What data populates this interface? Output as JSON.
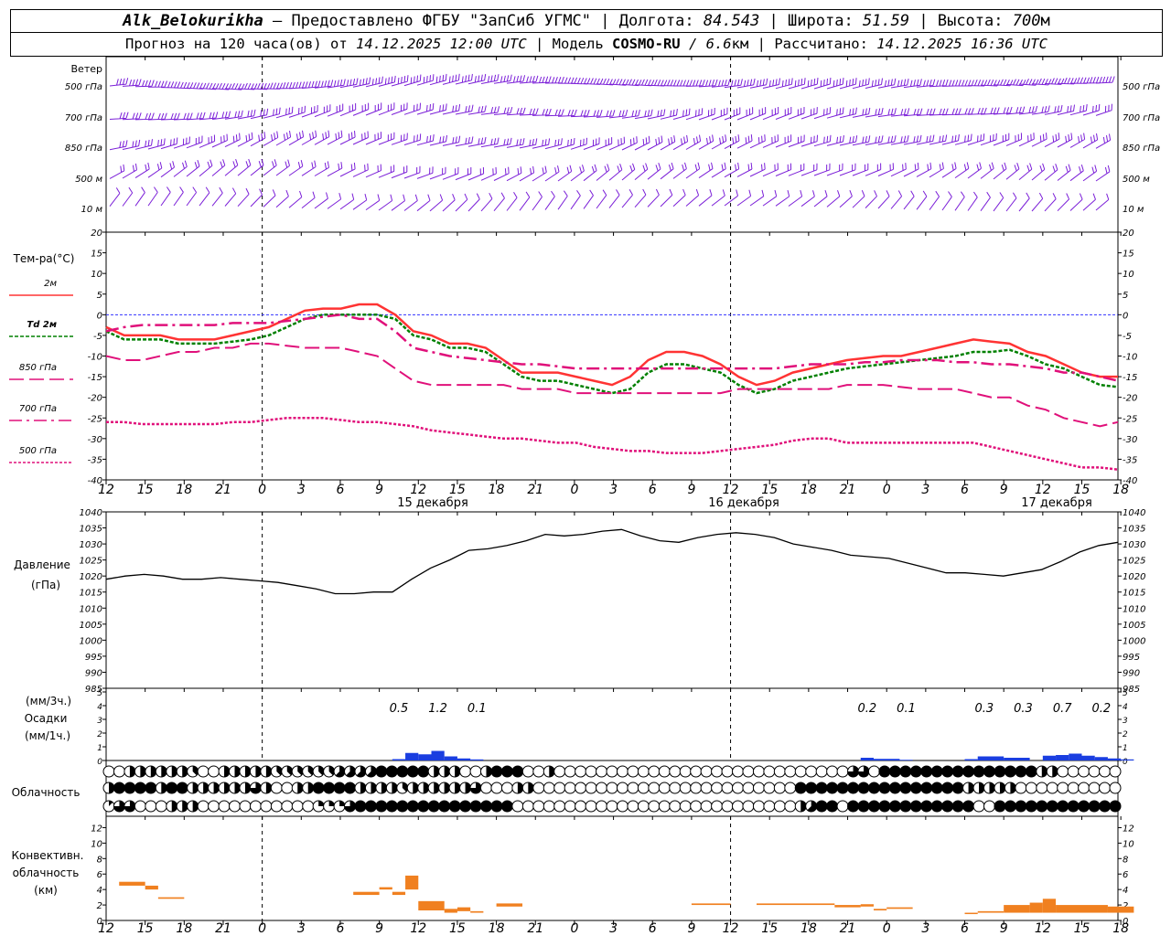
{
  "header": {
    "station": "Alk_Belokurikha",
    "dash": " – ",
    "provider": "Предоставлено ФГБУ \"ЗапСиб УГМС\"",
    "lon_label": "Долгота:",
    "lon_value": "84.543",
    "lat_label": "Широта:",
    "lat_value": "51.59",
    "alt_label": "Высота:",
    "alt_value": "700",
    "alt_unit": "м",
    "sep": " | ",
    "forecast_prefix": "Прогноз на 120 часа(ов) от ",
    "forecast_time": "14.12.2025 12:00 UTC",
    "model_label": "Модель ",
    "model_name": "COSMO-RU",
    "model_res": " / 6.6",
    "model_res_unit": "км",
    "calc_label": "Рассчитано: ",
    "calc_time": "14.12.2025 16:36 UTC"
  },
  "time_axis": {
    "ticks": [
      "12",
      "15",
      "18",
      "21",
      "0",
      "3",
      "6",
      "9",
      "12",
      "15",
      "18",
      "21",
      "0",
      "3",
      "6",
      "9",
      "12",
      "15",
      "18",
      "21",
      "0",
      "3",
      "6",
      "9",
      "12",
      "15",
      "18"
    ],
    "day_labels": [
      "15 декабря",
      "16 декабря",
      "17 декабря"
    ]
  },
  "chart_data": [
    {
      "id": "wind",
      "type": "line",
      "title": "Ветер",
      "levels": [
        "500 гПа",
        "700 гПа",
        "850 гПа",
        "500 м",
        "10 м"
      ]
    },
    {
      "id": "temperature",
      "type": "line",
      "ylabel": "Тем-ра(°С)",
      "ylim": [
        -40,
        20
      ],
      "yticks": [
        20,
        15,
        10,
        5,
        0,
        -5,
        -10,
        -15,
        -20,
        -25,
        -30,
        -35,
        -40
      ],
      "series": [
        {
          "name": "2м",
          "color": "#ff3333",
          "values": [
            -3,
            -5,
            -5,
            -5,
            -6,
            -6,
            -6,
            -5,
            -4,
            -3,
            -1,
            1,
            1.5,
            1.5,
            2.5,
            2.5,
            0,
            -4,
            -5,
            -7,
            -7,
            -8,
            -11,
            -14,
            -14,
            -14,
            -15,
            -16,
            -17,
            -15,
            -11,
            -9,
            -9,
            -10,
            -12,
            -15,
            -17,
            -16,
            -14,
            -13,
            -12,
            -11,
            -10.5,
            -10,
            -10,
            -9,
            -8,
            -7,
            -6,
            -6.5,
            -7,
            -9,
            -10,
            -12,
            -14,
            -15,
            -15
          ]
        },
        {
          "name": "Td 2м",
          "color": "#008000",
          "values": [
            -4,
            -6,
            -6,
            -6,
            -7,
            -7,
            -7,
            -6.5,
            -6,
            -5,
            -3,
            -1,
            0,
            0,
            0,
            0,
            -1,
            -5,
            -6,
            -8,
            -8,
            -9,
            -12,
            -15,
            -16,
            -16,
            -17,
            -18,
            -19,
            -18,
            -14,
            -12,
            -12,
            -13,
            -14,
            -17,
            -19,
            -18,
            -16,
            -15,
            -14,
            -13,
            -12.5,
            -12,
            -11.5,
            -11,
            -10.5,
            -10,
            -9,
            -9,
            -8.5,
            -10,
            -12,
            -13,
            -15,
            -17,
            -17.5
          ]
        },
        {
          "name": "850 гПа",
          "color": "#e0107a",
          "values": [
            -10,
            -11,
            -11,
            -10,
            -9,
            -9,
            -8,
            -8,
            -7,
            -7,
            -7.5,
            -8,
            -8,
            -8,
            -9,
            -10,
            -13,
            -16,
            -17,
            -17,
            -17,
            -17,
            -17,
            -18,
            -18,
            -18,
            -19,
            -19,
            -19,
            -19,
            -19,
            -19,
            -19,
            -19,
            -19,
            -18,
            -18,
            -18,
            -18,
            -18,
            -18,
            -17,
            -17,
            -17,
            -17.5,
            -18,
            -18,
            -18,
            -19,
            -20,
            -20,
            -22,
            -23,
            -25,
            -26,
            -27,
            -26
          ]
        },
        {
          "name": "700 гПа",
          "color": "#e0107a",
          "values": [
            -4,
            -3,
            -2.5,
            -2.5,
            -2.5,
            -2.5,
            -2.5,
            -2,
            -2,
            -2,
            -1.5,
            -1,
            -0.5,
            0,
            -1,
            -1,
            -4,
            -8,
            -9,
            -10,
            -10.5,
            -11,
            -11.5,
            -12,
            -12,
            -12.5,
            -13,
            -13,
            -13,
            -13,
            -13,
            -13,
            -13,
            -13,
            -13,
            -13,
            -13,
            -13,
            -12.5,
            -12,
            -12,
            -12,
            -11.5,
            -11.5,
            -11,
            -11,
            -11,
            -11.5,
            -11.5,
            -12,
            -12,
            -12.5,
            -13,
            -14,
            -14,
            -15,
            -16
          ]
        },
        {
          "name": "500 гПа",
          "color": "#e0107a",
          "values": [
            -26,
            -26,
            -26.5,
            -26.5,
            -26.5,
            -26.5,
            -26.5,
            -26,
            -26,
            -25.5,
            -25,
            -25,
            -25,
            -25.5,
            -26,
            -26,
            -26.5,
            -27,
            -28,
            -28.5,
            -29,
            -29.5,
            -30,
            -30,
            -30.5,
            -31,
            -31,
            -32,
            -32.5,
            -33,
            -33,
            -33.5,
            -33.5,
            -33.5,
            -33,
            -32.5,
            -32,
            -31.5,
            -30.5,
            -30,
            -30,
            -31,
            -31,
            -31,
            -31,
            -31,
            -31,
            -31,
            -31,
            -32,
            -33,
            -34,
            -35,
            -36,
            -37,
            -37,
            -37.5
          ]
        }
      ]
    },
    {
      "id": "pressure",
      "type": "line",
      "ylabel": "Давление",
      "yunit": "(гПа)",
      "ylim": [
        985,
        1040
      ],
      "yticks": [
        1040,
        1035,
        1030,
        1025,
        1020,
        1015,
        1010,
        1005,
        1000,
        995,
        990,
        985
      ],
      "series": [
        {
          "name": "Давление",
          "color": "#000000",
          "values": [
            1019,
            1020,
            1020.5,
            1020,
            1019,
            1019,
            1019.5,
            1019,
            1018.5,
            1018,
            1017,
            1016,
            1014.5,
            1014.5,
            1015,
            1015,
            1019,
            1022.5,
            1025,
            1028,
            1028.5,
            1029.5,
            1031,
            1033,
            1032.5,
            1033,
            1034,
            1034.5,
            1032.5,
            1031,
            1030.5,
            1032,
            1033,
            1033.5,
            1033,
            1032,
            1030,
            1029,
            1028,
            1026.5,
            1026,
            1025.5,
            1024,
            1022.5,
            1021,
            1021,
            1020.5,
            1020,
            1021,
            1022,
            1024.5,
            1027.5,
            1029.5,
            1030.5
          ]
        }
      ]
    },
    {
      "id": "precipitation",
      "type": "bar",
      "ylabel": "(мм/3ч.)",
      "title": "Осадки",
      "yunit": "(мм/1ч.)",
      "ylim": [
        0,
        5
      ],
      "yticks": [
        5,
        4,
        3,
        2,
        1,
        0
      ],
      "totals": [
        {
          "t": 22.5,
          "label": "0.5"
        },
        {
          "t": 25.5,
          "label": "1.2"
        },
        {
          "t": 28.5,
          "label": "0.1"
        },
        {
          "t": 58.5,
          "label": "0.2"
        },
        {
          "t": 61.5,
          "label": "0.1"
        },
        {
          "t": 67.5,
          "label": "0.3"
        },
        {
          "t": 70.5,
          "label": "0.3"
        },
        {
          "t": 73.5,
          "label": "0.7"
        },
        {
          "t": 76.5,
          "label": "0.2"
        }
      ],
      "bars": [
        {
          "t0": 22,
          "t1": 23,
          "v": 0.1
        },
        {
          "t0": 23,
          "t1": 24,
          "v": 0.55
        },
        {
          "t0": 24,
          "t1": 25,
          "v": 0.45
        },
        {
          "t0": 25,
          "t1": 26,
          "v": 0.7
        },
        {
          "t0": 26,
          "t1": 27,
          "v": 0.3
        },
        {
          "t0": 27,
          "t1": 28,
          "v": 0.15
        },
        {
          "t0": 28,
          "t1": 29,
          "v": 0.08
        },
        {
          "t0": 58,
          "t1": 59,
          "v": 0.2
        },
        {
          "t0": 59,
          "t1": 61,
          "v": 0.12
        },
        {
          "t0": 61,
          "t1": 62,
          "v": 0.05
        },
        {
          "t0": 66,
          "t1": 67,
          "v": 0.1
        },
        {
          "t0": 67,
          "t1": 69,
          "v": 0.3
        },
        {
          "t0": 69,
          "t1": 71,
          "v": 0.2
        },
        {
          "t0": 72,
          "t1": 73,
          "v": 0.35
        },
        {
          "t0": 73,
          "t1": 74,
          "v": 0.4
        },
        {
          "t0": 74,
          "t1": 75,
          "v": 0.5
        },
        {
          "t0": 75,
          "t1": 76,
          "v": 0.35
        },
        {
          "t0": 76,
          "t1": 77,
          "v": 0.25
        },
        {
          "t0": 77,
          "t1": 78,
          "v": 0.15
        },
        {
          "t0": 78,
          "t1": 79,
          "v": 0.08
        }
      ]
    },
    {
      "id": "cloudiness",
      "type": "table",
      "ylabel": "Облачность",
      "rows": [
        "0044444430044444333333555588888444004888004000000000000000000000000000066088888888888888844000000",
        "4888848844444464004488884444344444460004400000000000000000000000008888888888888888444440000000000",
        "1660004440000000000022268888888888888880000000000000000000000000004588088888888888800888888888888"
      ]
    },
    {
      "id": "convective",
      "type": "bar",
      "ylabel": "Конвективн.",
      "title": "облачность",
      "yunit": "(км)",
      "ylim": [
        0,
        13
      ],
      "yticks": [
        12,
        10,
        8,
        6,
        4,
        2,
        0
      ],
      "bars": [
        {
          "t0": 1,
          "t1": 3,
          "lo": 4.5,
          "hi": 5
        },
        {
          "t0": 3,
          "t1": 4,
          "lo": 4,
          "hi": 4.5
        },
        {
          "t0": 4,
          "t1": 6,
          "lo": 2.8,
          "hi": 3
        },
        {
          "t0": 19,
          "t1": 21,
          "lo": 3.3,
          "hi": 3.7
        },
        {
          "t0": 21,
          "t1": 22,
          "lo": 4,
          "hi": 4.3
        },
        {
          "t0": 22,
          "t1": 23,
          "lo": 3.3,
          "hi": 3.7
        },
        {
          "t0": 23,
          "t1": 24,
          "lo": 4,
          "hi": 5.8
        },
        {
          "t0": 24,
          "t1": 26,
          "lo": 1.3,
          "hi": 2.5
        },
        {
          "t0": 26,
          "t1": 27,
          "lo": 1,
          "hi": 1.5
        },
        {
          "t0": 27,
          "t1": 28,
          "lo": 1.2,
          "hi": 1.7
        },
        {
          "t0": 28,
          "t1": 29,
          "lo": 1,
          "hi": 1.2
        },
        {
          "t0": 30,
          "t1": 32,
          "lo": 1.8,
          "hi": 2.2
        },
        {
          "t0": 45,
          "t1": 48,
          "lo": 2,
          "hi": 2.2
        },
        {
          "t0": 50,
          "t1": 56,
          "lo": 2,
          "hi": 2.2
        },
        {
          "t0": 56,
          "t1": 58,
          "lo": 1.7,
          "hi": 2
        },
        {
          "t0": 58,
          "t1": 59,
          "lo": 1.8,
          "hi": 2.1
        },
        {
          "t0": 59,
          "t1": 60,
          "lo": 1.3,
          "hi": 1.5
        },
        {
          "t0": 60,
          "t1": 62,
          "lo": 1.5,
          "hi": 1.7
        },
        {
          "t0": 66,
          "t1": 67,
          "lo": 0.9,
          "hi": 1
        },
        {
          "t0": 67,
          "t1": 69,
          "lo": 1,
          "hi": 1.2
        },
        {
          "t0": 69,
          "t1": 71,
          "lo": 1,
          "hi": 2
        },
        {
          "t0": 71,
          "t1": 72,
          "lo": 1,
          "hi": 2.3
        },
        {
          "t0": 72,
          "t1": 73,
          "lo": 1,
          "hi": 2.8
        },
        {
          "t0": 73,
          "t1": 77,
          "lo": 1,
          "hi": 2
        },
        {
          "t0": 77,
          "t1": 79,
          "lo": 1,
          "hi": 1.8
        }
      ]
    }
  ],
  "colors": {
    "wind_barbs": "#7b1fd8",
    "precip": "#1a3ee0",
    "convective": "#f08020",
    "zero_line": "#3030ff",
    "grid_dash": "#000000"
  }
}
